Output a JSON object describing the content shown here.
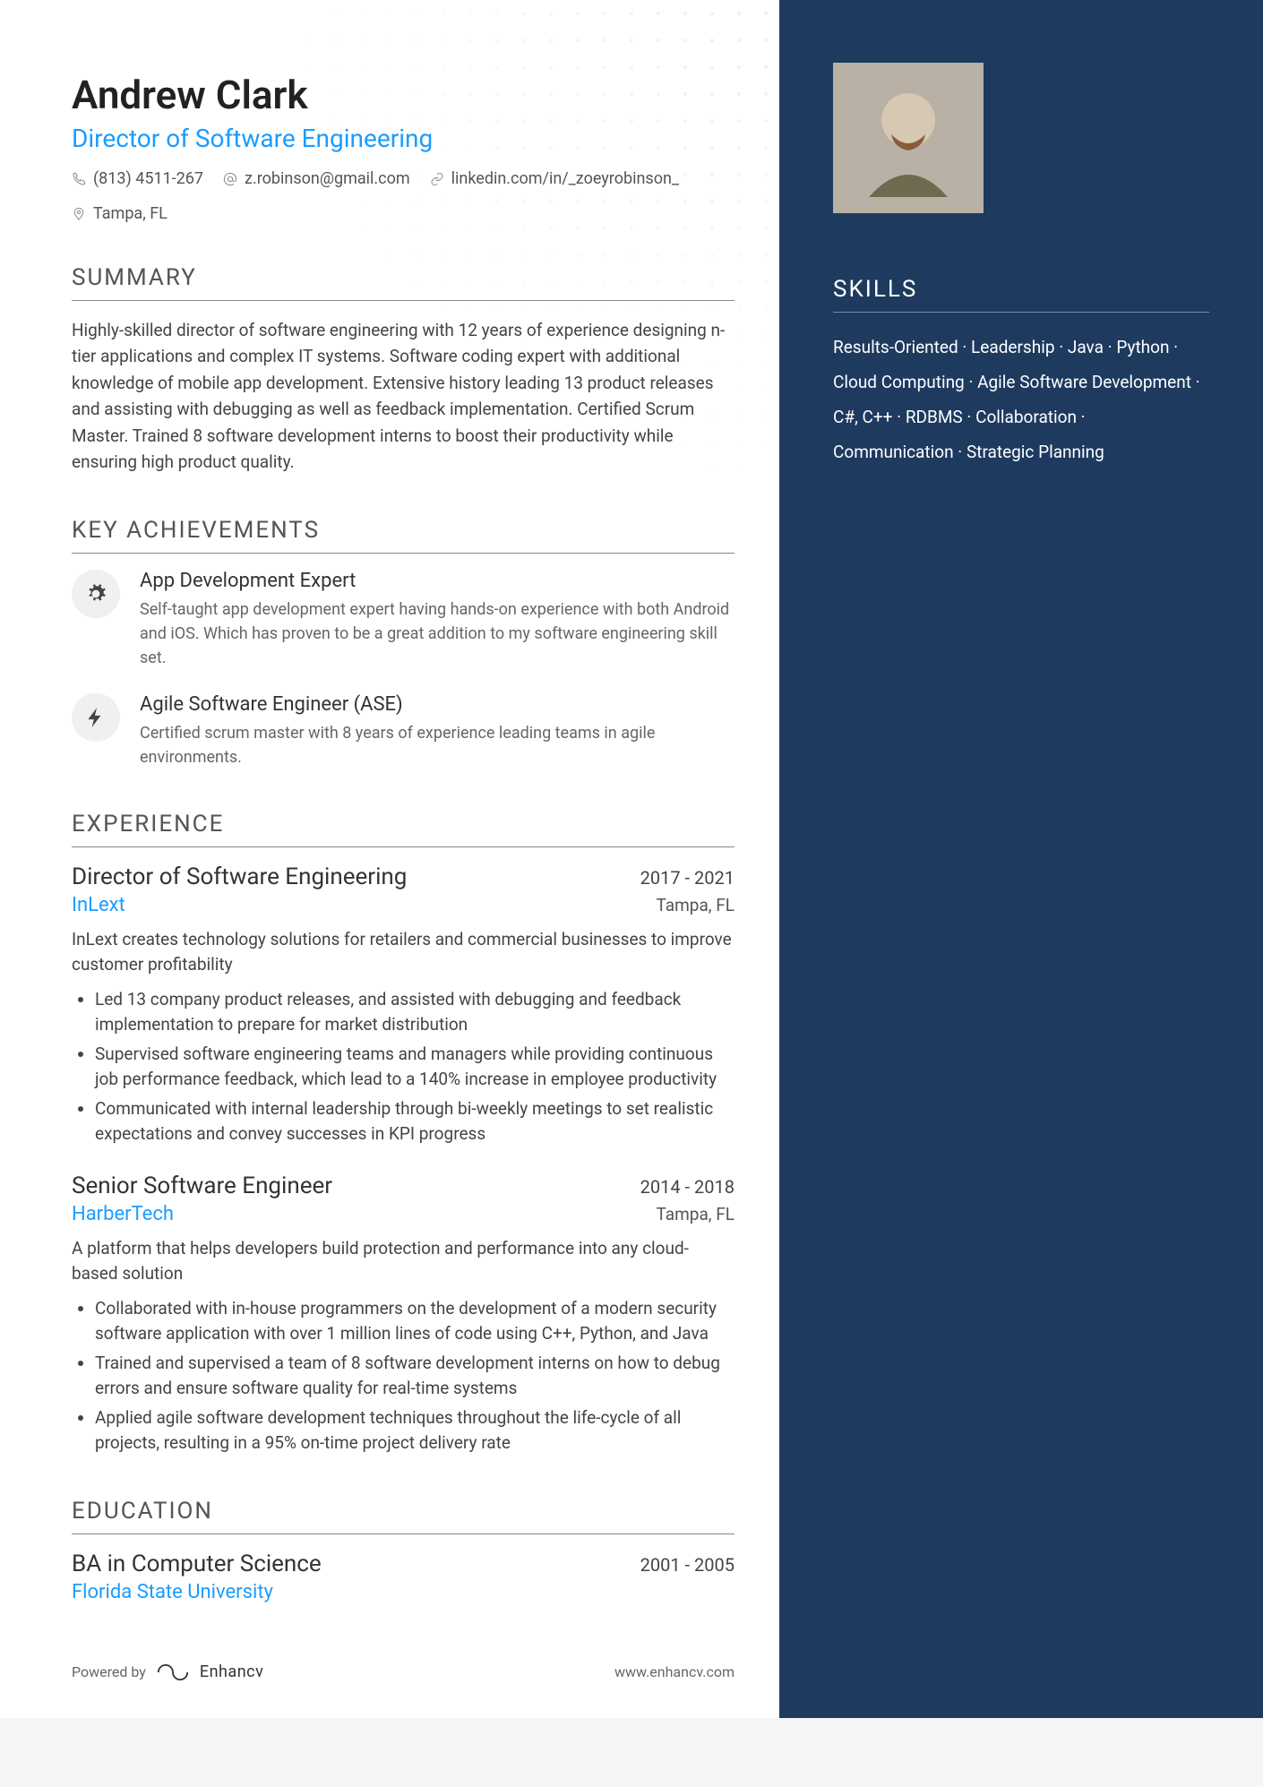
{
  "header": {
    "name": "Andrew Clark",
    "title": "Director of Software Engineering",
    "phone": "(813) 4511-267",
    "email": "z.robinson@gmail.com",
    "linkedin": "linkedin.com/in/_zoeyrobinson_",
    "location": "Tampa, FL"
  },
  "sections": {
    "summary_h": "SUMMARY",
    "summary": "Highly-skilled director of software engineering with 12 years of experience designing n-tier applications and complex IT systems. Software coding expert with additional knowledge of mobile app development. Extensive history leading 13 product releases and assisting with debugging as well as feedback implementation. Certified Scrum Master.  Trained 8 software development interns to boost their productivity while ensuring high product quality.",
    "achievements_h": "KEY ACHIEVEMENTS",
    "achievements": [
      {
        "icon": "gears",
        "title": "App Development Expert",
        "desc": "Self-taught app development expert having hands-on experience with both Android and iOS. Which has proven to be a great addition to my software engineering skill set."
      },
      {
        "icon": "bolt",
        "title": "Agile Software Engineer (ASE)",
        "desc": "Certified scrum master with 8 years of experience leading teams in agile environments."
      }
    ],
    "experience_h": "EXPERIENCE",
    "experience": [
      {
        "role": "Director of Software Engineering",
        "dates": "2017 - 2021",
        "company": "InLext",
        "location": "Tampa, FL",
        "desc": "InLext creates technology solutions for retailers and commercial businesses to improve customer profitability",
        "bullets": [
          "Led 13 company product releases, and assisted with debugging and feedback implementation to prepare for market distribution",
          "Supervised software engineering teams and managers while providing continuous job performance feedback, which lead to a 140% increase in employee productivity",
          "Communicated with internal leadership through bi-weekly meetings to set realistic expectations and convey successes in KPI progress"
        ]
      },
      {
        "role": "Senior Software Engineer",
        "dates": "2014 - 2018",
        "company": "HarberTech",
        "location": "Tampa, FL",
        "desc": "A platform that helps developers build protection and performance into any cloud-based solution",
        "bullets": [
          "Collaborated with in-house programmers on the development of a modern security software application with over 1 million lines of code using C++, Python, and Java",
          "Trained and supervised a team of 8 software development interns on how to debug errors and ensure software quality for real-time systems",
          "Applied agile software development techniques throughout the life-cycle of all projects, resulting in a 95% on-time project delivery rate"
        ]
      }
    ],
    "education_h": "EDUCATION",
    "education": {
      "degree": "BA in Computer Science",
      "dates": "2001 - 2005",
      "school": "Florida State University"
    }
  },
  "sidebar": {
    "skills_h": "SKILLS",
    "skills": [
      "Results-Oriented",
      "Leadership",
      "Java",
      "Python",
      "Cloud Computing",
      "Agile Software Development",
      "C#, C++",
      "RDBMS",
      "Collaboration",
      "Communication",
      "Strategic Planning"
    ]
  },
  "footer": {
    "powered": "Powered by",
    "brand": "Enhancv",
    "url": "www.enhancv.com"
  }
}
